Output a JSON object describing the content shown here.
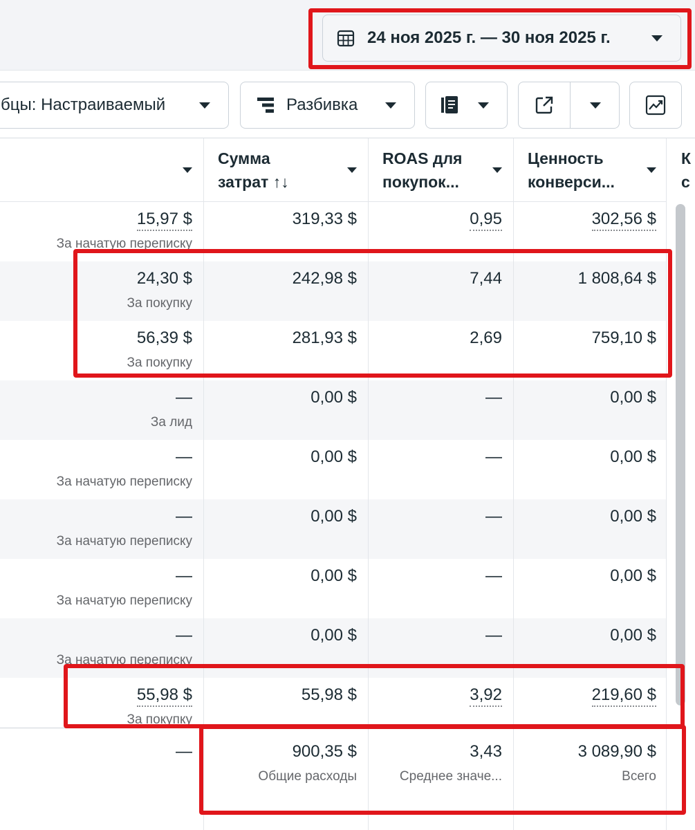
{
  "header": {
    "date_range": "24 ноя 2025 г. — 30 ноя 2025 г."
  },
  "toolbar": {
    "columns_label": "бцы: Настраиваемый",
    "breakdown_label": "Разбивка"
  },
  "table": {
    "columns": [
      {
        "label": ""
      },
      {
        "label_line1": "Сумма",
        "label_line2": "затрат ↑↓"
      },
      {
        "label_line1": "ROAS для",
        "label_line2": "покупок..."
      },
      {
        "label_line1": "Ценность",
        "label_line2": "конверси..."
      }
    ],
    "cut_column": {
      "line1": "К",
      "line2": "с"
    },
    "rows": [
      {
        "c0": "15,97 $",
        "c0_sub": "За начатую переписку",
        "c1": "319,33 $",
        "c2": "0,95",
        "c3": "302,56 $"
      },
      {
        "c0": "24,30 $",
        "c0_sub": "За покупку",
        "c1": "242,98 $",
        "c2": "7,44",
        "c3": "1 808,64 $"
      },
      {
        "c0": "56,39 $",
        "c0_sub": "За покупку",
        "c1": "281,93 $",
        "c2": "2,69",
        "c3": "759,10 $"
      },
      {
        "c0": "—",
        "c0_sub": "За лид",
        "c1": "0,00 $",
        "c2": "—",
        "c3": "0,00 $"
      },
      {
        "c0": "—",
        "c0_sub": "За начатую переписку",
        "c1": "0,00 $",
        "c2": "—",
        "c3": "0,00 $"
      },
      {
        "c0": "—",
        "c0_sub": "За начатую переписку",
        "c1": "0,00 $",
        "c2": "—",
        "c3": "0,00 $"
      },
      {
        "c0": "—",
        "c0_sub": "За начатую переписку",
        "c1": "0,00 $",
        "c2": "—",
        "c3": "0,00 $"
      },
      {
        "c0": "—",
        "c0_sub": "За начатую переписку",
        "c1": "0,00 $",
        "c2": "—",
        "c3": "0,00 $"
      },
      {
        "c0": "55,98 $",
        "c0_sub": "За покупку",
        "c1": "55,98 $",
        "c2": "3,92",
        "c3": "219,60 $"
      }
    ],
    "totals": {
      "c0": "—",
      "c1": "900,35 $",
      "c1_sub": "Общие расходы",
      "c2": "3,43",
      "c2_sub": "Среднее значе...",
      "c3": "3 089,90 $",
      "c3_sub": "Всего"
    }
  },
  "colors": {
    "highlight": "#e0161b",
    "row_alt": "#f5f6f8",
    "text": "#1c2b33",
    "subtext": "#65676b"
  }
}
